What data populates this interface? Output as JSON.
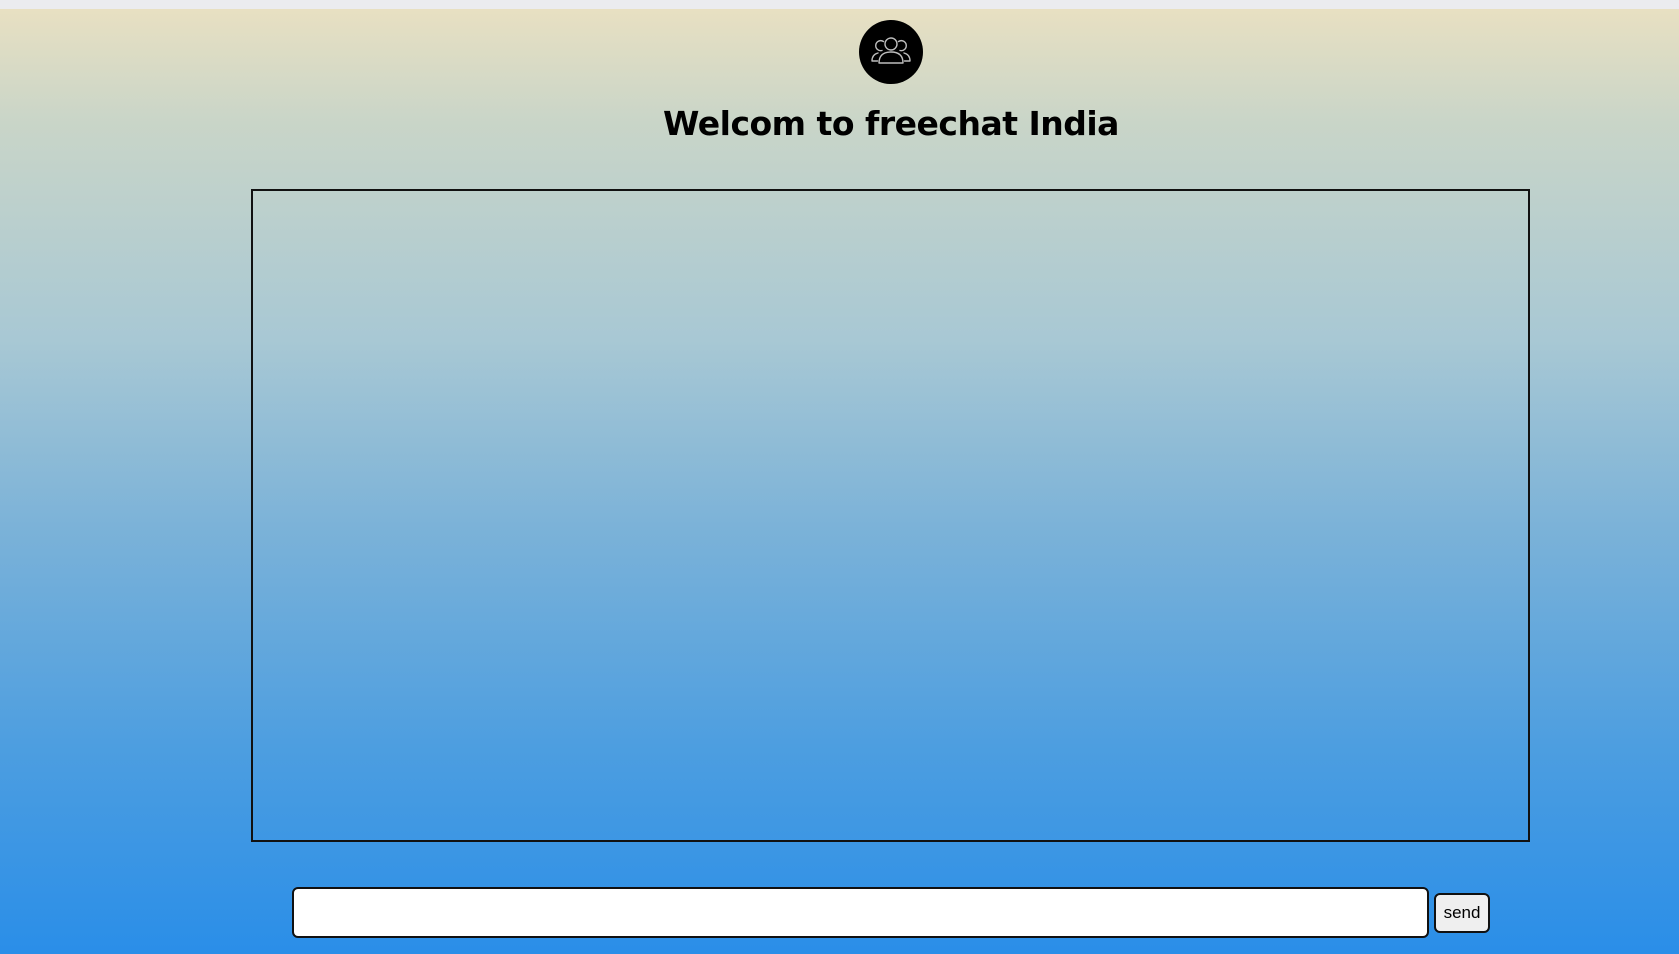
{
  "header": {
    "logo_icon": "users-group-icon",
    "title": "Welcom to freechat India"
  },
  "chat": {
    "messages": []
  },
  "composer": {
    "input_value": "",
    "input_placeholder": "",
    "send_label": "send"
  },
  "colors": {
    "gradient_top": "#e8e0c2",
    "gradient_bottom": "#2a8ee8",
    "logo_background": "#000000",
    "border": "#111111"
  }
}
